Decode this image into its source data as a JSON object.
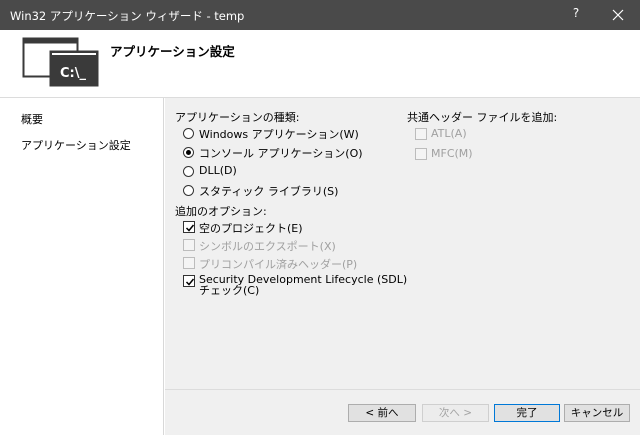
{
  "window": {
    "title": "Win32 アプリケーション ウィザード - temp",
    "help_glyph": "?"
  },
  "header": {
    "title": "アプリケーション設定",
    "logo_text": "C:\\_"
  },
  "sidebar": {
    "items": [
      {
        "label": "概要"
      },
      {
        "label": "アプリケーション設定"
      }
    ]
  },
  "app_type": {
    "label": "アプリケーションの種類:",
    "options": [
      {
        "label": "Windows アプリケーション(W)",
        "selected": false
      },
      {
        "label": "コンソール アプリケーション(O)",
        "selected": true
      },
      {
        "label": "DLL(D)",
        "selected": false
      },
      {
        "label": "スタティック ライブラリ(S)",
        "selected": false
      }
    ]
  },
  "additional": {
    "label": "追加のオプション:",
    "options": [
      {
        "label": "空のプロジェクト(E)",
        "checked": true,
        "enabled": true
      },
      {
        "label": "シンボルのエクスポート(X)",
        "checked": false,
        "enabled": false
      },
      {
        "label": "プリコンパイル済みヘッダー(P)",
        "checked": false,
        "enabled": false
      },
      {
        "label_line1": "Security Development Lifecycle (SDL)",
        "label_line2": "チェック(C)",
        "checked": true,
        "enabled": true
      }
    ]
  },
  "common_headers": {
    "label": "共通ヘッダー ファイルを追加:",
    "options": [
      {
        "label": "ATL(A)",
        "checked": false,
        "enabled": false
      },
      {
        "label": "MFC(M)",
        "checked": false,
        "enabled": false
      }
    ]
  },
  "buttons": {
    "prev": "< 前へ",
    "next": "次へ >",
    "finish": "完了",
    "cancel": "キャンセル"
  }
}
